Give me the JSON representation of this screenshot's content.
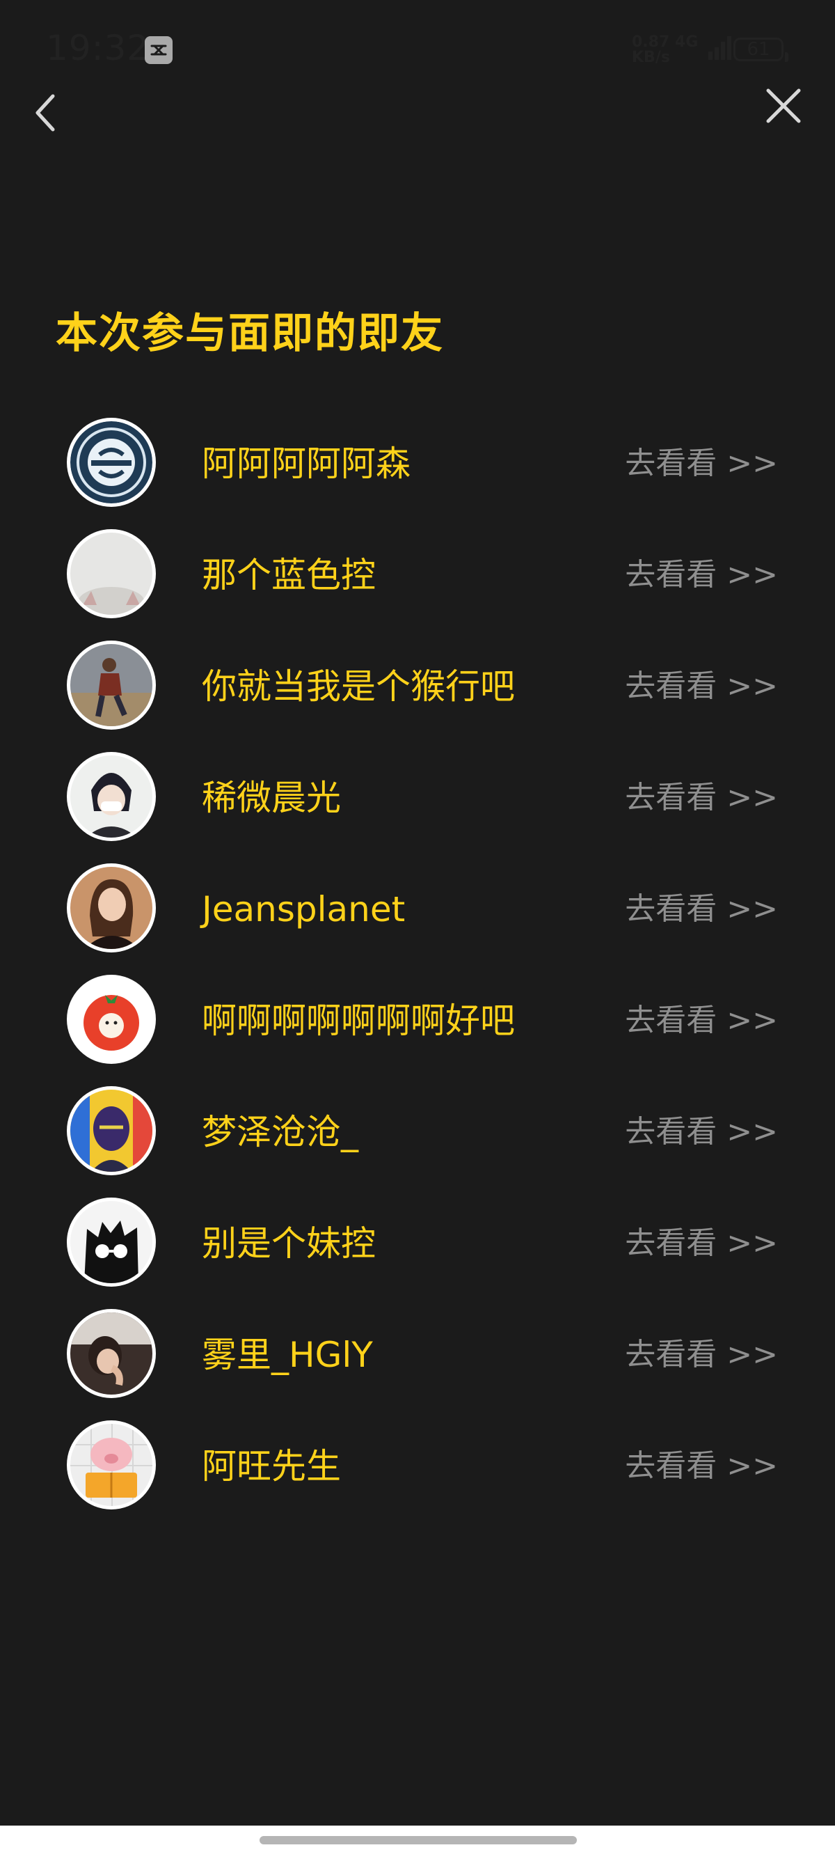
{
  "status_bar": {
    "time": "19:32",
    "net_speed_value": "0.87",
    "net_speed_unit": "KB/s",
    "network_type": "4G",
    "battery_level": "61"
  },
  "nav": {
    "back_icon": "chevron-left-icon",
    "close_icon": "close-icon"
  },
  "title": "本次参与面即的即友",
  "view_label": "去看看 >>",
  "friends": [
    {
      "name": "阿阿阿阿阿森"
    },
    {
      "name": "那个蓝色控"
    },
    {
      "name": "你就当我是个猴行吧"
    },
    {
      "name": "稀微晨光"
    },
    {
      "name": "Jeansplanet"
    },
    {
      "name": "啊啊啊啊啊啊啊好吧"
    },
    {
      "name": "梦泽沧沧_"
    },
    {
      "name": "别是个妹控"
    },
    {
      "name": "雾里_HGlY"
    },
    {
      "name": "阿旺先生"
    }
  ],
  "colors": {
    "background": "#1b1b1b",
    "accent_yellow": "#ffd21a",
    "secondary_text": "#8f8f8f"
  }
}
